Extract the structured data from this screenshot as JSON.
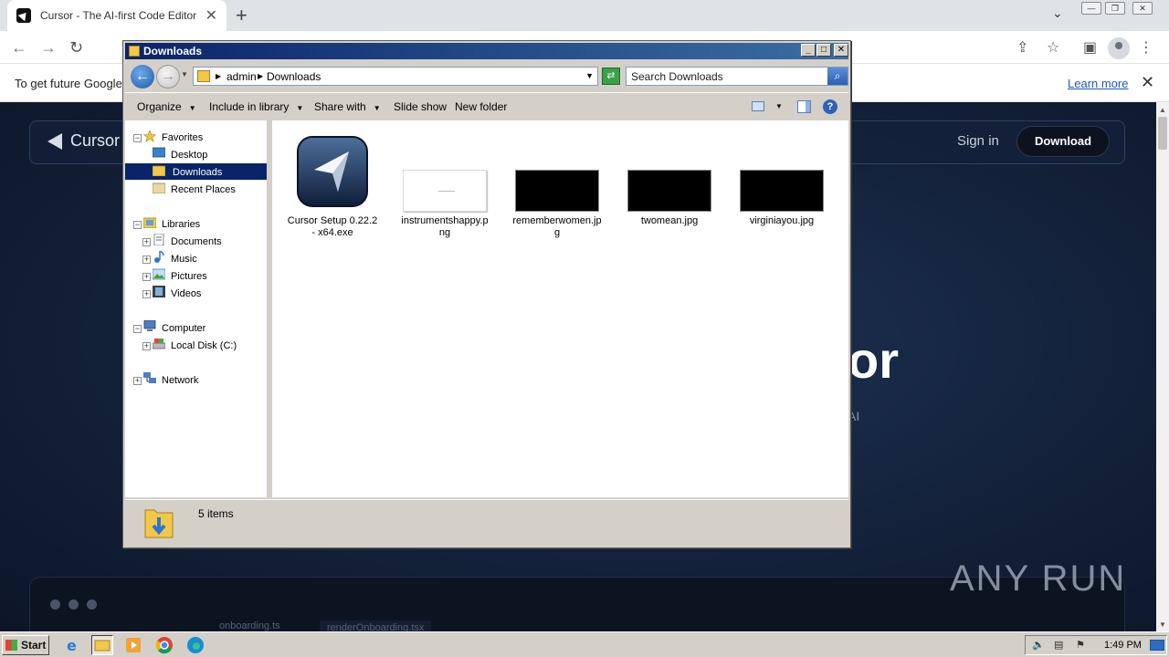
{
  "browser": {
    "tab_title": "Cursor - The AI-first Code Editor",
    "infobar_message": "To get future Google",
    "infobar_link": "Learn more"
  },
  "website": {
    "brand": "Cursor",
    "sign_in": "Sign in",
    "download": "Download",
    "hero_fragment": "or",
    "sub_fragment": "AI",
    "editor_tabs": [
      "onboarding.ts",
      "renderOnboarding.tsx"
    ],
    "watermark": "ANY RUN"
  },
  "explorer": {
    "title": "Downloads",
    "address": [
      "admin",
      "Downloads"
    ],
    "search_placeholder": "Search Downloads",
    "commands": [
      "Organize",
      "Include in library",
      "Share with",
      "Slide show",
      "New folder"
    ],
    "nav": {
      "favorites": "Favorites",
      "desktop": "Desktop",
      "downloads": "Downloads",
      "recent_places": "Recent Places",
      "libraries": "Libraries",
      "documents": "Documents",
      "music": "Music",
      "pictures": "Pictures",
      "videos": "Videos",
      "computer": "Computer",
      "local_disk": "Local Disk (C:)",
      "network": "Network"
    },
    "files": [
      {
        "name": "Cursor Setup 0.22.2 - x64.exe",
        "kind": "exe"
      },
      {
        "name": "instrumentshappy.png",
        "kind": "png"
      },
      {
        "name": "rememberwomen.jpg",
        "kind": "jpg"
      },
      {
        "name": "twomean.jpg",
        "kind": "jpg"
      },
      {
        "name": "virginiayou.jpg",
        "kind": "jpg"
      }
    ],
    "status": "5 items"
  },
  "taskbar": {
    "start": "Start",
    "time": "1:49 PM"
  },
  "colors": {
    "titlebar": "#0a246a",
    "selection": "#0a246a",
    "site_bg": "#13213a"
  }
}
